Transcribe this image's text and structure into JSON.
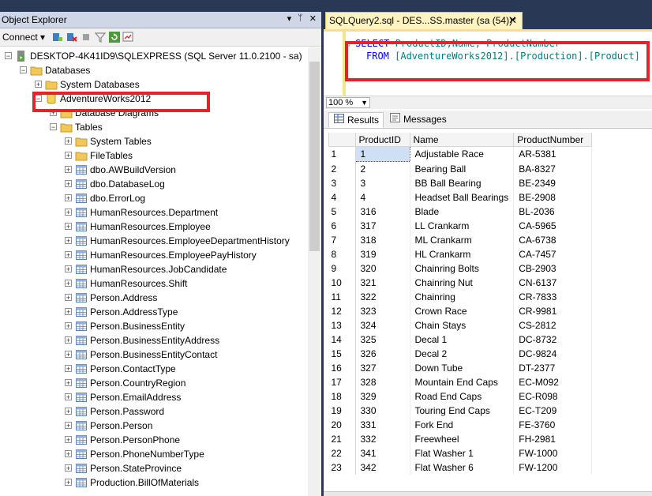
{
  "object_explorer": {
    "title": "Object Explorer",
    "pin_glyph": "▾ ᛘ ✕",
    "connect_label": "Connect ▾",
    "toolbar_icons": [
      "connect-icon",
      "disconnect-icon",
      "stop-icon",
      "filter-icon",
      "refresh-icon",
      "activity-icon"
    ],
    "tree": [
      {
        "label": "DESKTOP-4K41ID9\\SQLEXPRESS (SQL Server 11.0.2100 - sa)",
        "depth": 0,
        "expander": "−",
        "icon": "server-icon"
      },
      {
        "label": "Databases",
        "depth": 1,
        "expander": "−",
        "icon": "folder-icon"
      },
      {
        "label": "System Databases",
        "depth": 2,
        "expander": "+",
        "icon": "folder-icon"
      },
      {
        "label": "AdventureWorks2012",
        "depth": 2,
        "expander": "−",
        "icon": "database-icon"
      },
      {
        "label": "Database Diagrams",
        "depth": 3,
        "expander": "+",
        "icon": "folder-icon"
      },
      {
        "label": "Tables",
        "depth": 3,
        "expander": "−",
        "icon": "folder-icon"
      },
      {
        "label": "System Tables",
        "depth": 4,
        "expander": "+",
        "icon": "folder-icon"
      },
      {
        "label": "FileTables",
        "depth": 4,
        "expander": "+",
        "icon": "folder-icon"
      },
      {
        "label": "dbo.AWBuildVersion",
        "depth": 4,
        "expander": "+",
        "icon": "table-icon"
      },
      {
        "label": "dbo.DatabaseLog",
        "depth": 4,
        "expander": "+",
        "icon": "table-icon"
      },
      {
        "label": "dbo.ErrorLog",
        "depth": 4,
        "expander": "+",
        "icon": "table-icon"
      },
      {
        "label": "HumanResources.Department",
        "depth": 4,
        "expander": "+",
        "icon": "table-icon"
      },
      {
        "label": "HumanResources.Employee",
        "depth": 4,
        "expander": "+",
        "icon": "table-icon"
      },
      {
        "label": "HumanResources.EmployeeDepartmentHistory",
        "depth": 4,
        "expander": "+",
        "icon": "table-icon"
      },
      {
        "label": "HumanResources.EmployeePayHistory",
        "depth": 4,
        "expander": "+",
        "icon": "table-icon"
      },
      {
        "label": "HumanResources.JobCandidate",
        "depth": 4,
        "expander": "+",
        "icon": "table-icon"
      },
      {
        "label": "HumanResources.Shift",
        "depth": 4,
        "expander": "+",
        "icon": "table-icon"
      },
      {
        "label": "Person.Address",
        "depth": 4,
        "expander": "+",
        "icon": "table-icon"
      },
      {
        "label": "Person.AddressType",
        "depth": 4,
        "expander": "+",
        "icon": "table-icon"
      },
      {
        "label": "Person.BusinessEntity",
        "depth": 4,
        "expander": "+",
        "icon": "table-icon"
      },
      {
        "label": "Person.BusinessEntityAddress",
        "depth": 4,
        "expander": "+",
        "icon": "table-icon"
      },
      {
        "label": "Person.BusinessEntityContact",
        "depth": 4,
        "expander": "+",
        "icon": "table-icon"
      },
      {
        "label": "Person.ContactType",
        "depth": 4,
        "expander": "+",
        "icon": "table-icon"
      },
      {
        "label": "Person.CountryRegion",
        "depth": 4,
        "expander": "+",
        "icon": "table-icon"
      },
      {
        "label": "Person.EmailAddress",
        "depth": 4,
        "expander": "+",
        "icon": "table-icon"
      },
      {
        "label": "Person.Password",
        "depth": 4,
        "expander": "+",
        "icon": "table-icon"
      },
      {
        "label": "Person.Person",
        "depth": 4,
        "expander": "+",
        "icon": "table-icon"
      },
      {
        "label": "Person.PersonPhone",
        "depth": 4,
        "expander": "+",
        "icon": "table-icon"
      },
      {
        "label": "Person.PhoneNumberType",
        "depth": 4,
        "expander": "+",
        "icon": "table-icon"
      },
      {
        "label": "Person.StateProvince",
        "depth": 4,
        "expander": "+",
        "icon": "table-icon"
      },
      {
        "label": "Production.BillOfMaterials",
        "depth": 4,
        "expander": "+",
        "icon": "table-icon"
      }
    ]
  },
  "query_editor": {
    "tab_title": "SQLQuery2.sql - DES...SS.master (sa (54))*",
    "tab_close": "✕",
    "sql": {
      "line1_kw": "SELECT",
      "line1_rest": " ProductID,Name, ProductNumber",
      "line2_kw": "FROM",
      "line2_rest": " [AdventureWorks2012].[Production].[Product]"
    },
    "zoom": "100 %",
    "tabs": {
      "results": "Results",
      "messages": "Messages"
    },
    "columns": [
      "ProductID",
      "Name",
      "ProductNumber"
    ],
    "rows": [
      [
        "1",
        "1",
        "Adjustable Race",
        "AR-5381"
      ],
      [
        "2",
        "2",
        "Bearing Ball",
        "BA-8327"
      ],
      [
        "3",
        "3",
        "BB Ball Bearing",
        "BE-2349"
      ],
      [
        "4",
        "4",
        "Headset Ball Bearings",
        "BE-2908"
      ],
      [
        "5",
        "316",
        "Blade",
        "BL-2036"
      ],
      [
        "6",
        "317",
        "LL Crankarm",
        "CA-5965"
      ],
      [
        "7",
        "318",
        "ML Crankarm",
        "CA-6738"
      ],
      [
        "8",
        "319",
        "HL Crankarm",
        "CA-7457"
      ],
      [
        "9",
        "320",
        "Chainring Bolts",
        "CB-2903"
      ],
      [
        "10",
        "321",
        "Chainring Nut",
        "CN-6137"
      ],
      [
        "11",
        "322",
        "Chainring",
        "CR-7833"
      ],
      [
        "12",
        "323",
        "Crown Race",
        "CR-9981"
      ],
      [
        "13",
        "324",
        "Chain Stays",
        "CS-2812"
      ],
      [
        "14",
        "325",
        "Decal 1",
        "DC-8732"
      ],
      [
        "15",
        "326",
        "Decal 2",
        "DC-9824"
      ],
      [
        "16",
        "327",
        "Down Tube",
        "DT-2377"
      ],
      [
        "17",
        "328",
        "Mountain End Caps",
        "EC-M092"
      ],
      [
        "18",
        "329",
        "Road End Caps",
        "EC-R098"
      ],
      [
        "19",
        "330",
        "Touring End Caps",
        "EC-T209"
      ],
      [
        "20",
        "331",
        "Fork End",
        "FE-3760"
      ],
      [
        "21",
        "332",
        "Freewheel",
        "FH-2981"
      ],
      [
        "22",
        "341",
        "Flat Washer 1",
        "FW-1000"
      ],
      [
        "23",
        "342",
        "Flat Washer 6",
        "FW-1200"
      ]
    ]
  },
  "colors": {
    "highlight": "#e3232b",
    "selection": "#cfe0f5",
    "sql_keyword": "#0000ff",
    "sql_identifier": "#008080"
  }
}
